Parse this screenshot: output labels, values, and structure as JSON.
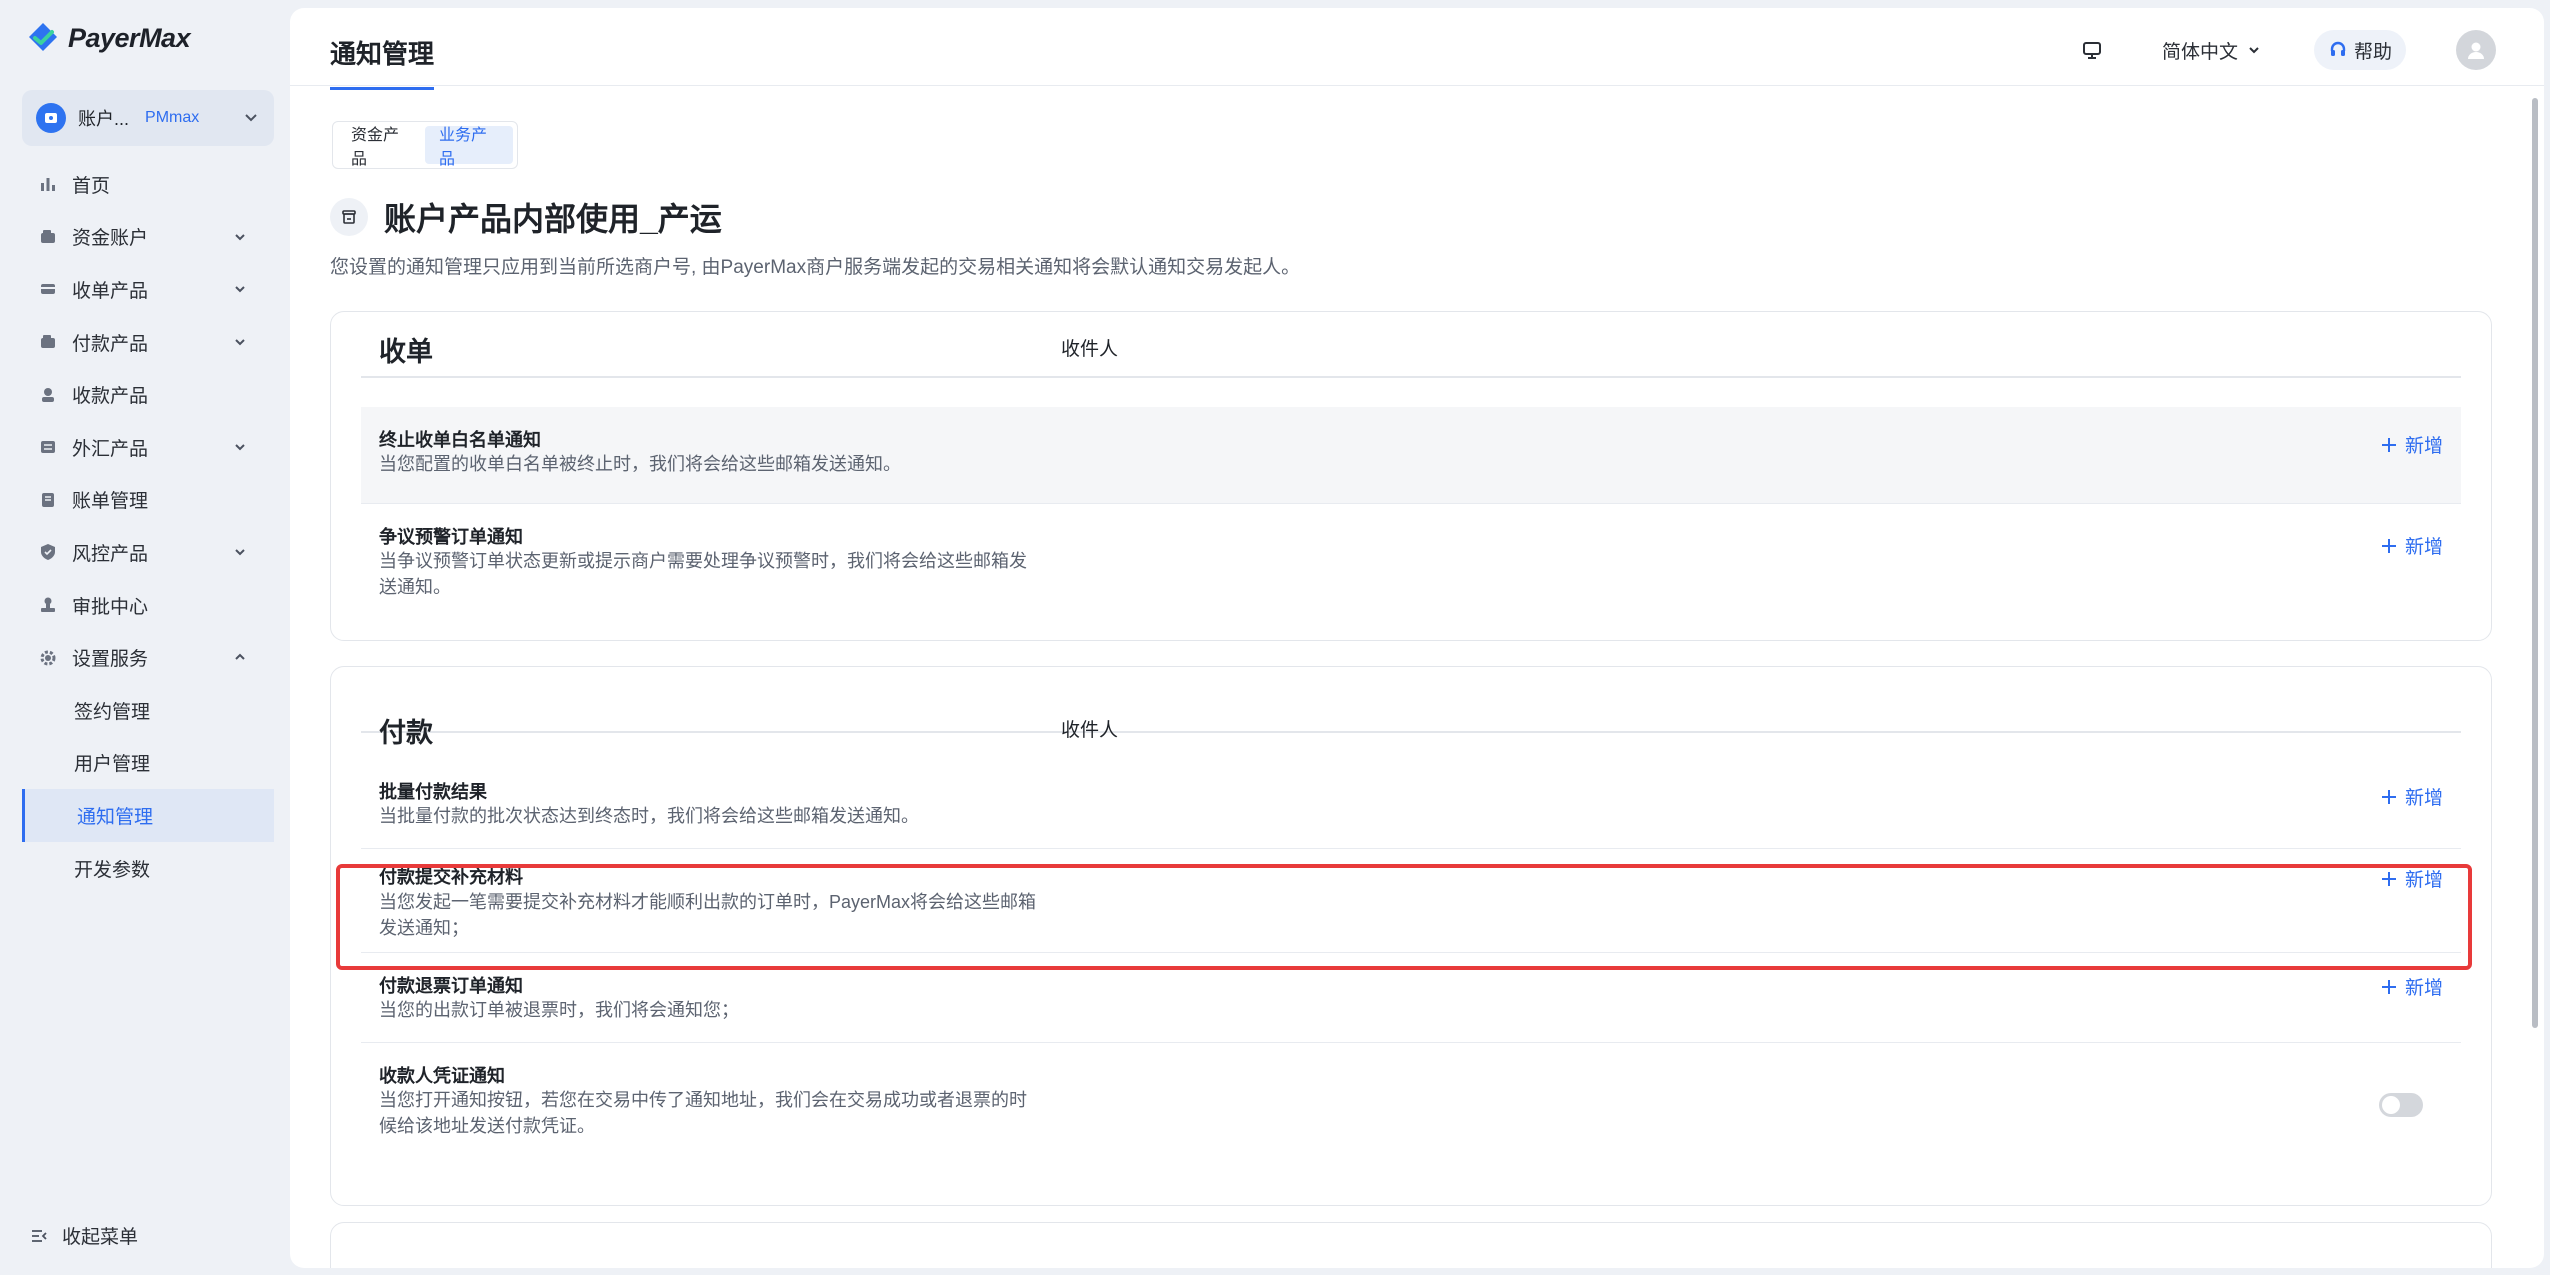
{
  "app": {
    "brand": "PayerMax",
    "colors": {
      "accent": "#2e6df0",
      "highlight": "#e83a3a",
      "sidebar_bg": "#eef1f6"
    }
  },
  "account": {
    "name": "账户...",
    "tag": "PMmax"
  },
  "sidebar": {
    "items": [
      {
        "label": "首页",
        "icon": "bar-chart-icon",
        "expandable": false
      },
      {
        "label": "资金账户",
        "icon": "wallet-icon",
        "expandable": true
      },
      {
        "label": "收单产品",
        "icon": "card-icon",
        "expandable": true
      },
      {
        "label": "付款产品",
        "icon": "wallet-icon",
        "expandable": true
      },
      {
        "label": "收款产品",
        "icon": "person-icon",
        "expandable": false
      },
      {
        "label": "外汇产品",
        "icon": "exchange-icon",
        "expandable": true
      },
      {
        "label": "账单管理",
        "icon": "bill-icon",
        "expandable": false
      },
      {
        "label": "风控产品",
        "icon": "shield-icon",
        "expandable": true
      },
      {
        "label": "审批中心",
        "icon": "stamp-icon",
        "expandable": false
      },
      {
        "label": "设置服务",
        "icon": "gear-icon",
        "expandable": true,
        "expanded": true
      }
    ],
    "sub_items": [
      {
        "label": "签约管理"
      },
      {
        "label": "用户管理"
      },
      {
        "label": "通知管理",
        "active": true
      },
      {
        "label": "开发参数"
      }
    ],
    "collapse_label": "收起菜单"
  },
  "header": {
    "tab": "通知管理",
    "language": "简体中文",
    "help": "帮助"
  },
  "segment": {
    "options": [
      "资金产品",
      "业务产品"
    ],
    "selected": "业务产品"
  },
  "page": {
    "title": "账户产品内部使用_产运",
    "description": "您设置的通知管理只应用到当前所选商户号, 由PayerMax商户服务端发起的交易相关通知将会默认通知交易发起人。"
  },
  "sections": [
    {
      "title": "收单",
      "receiver_header": "收件人",
      "rows": [
        {
          "title": "终止收单白名单通知",
          "desc": "当您配置的收单白名单被终止时，我们将会给这些邮箱发送通知。",
          "action": "新增"
        },
        {
          "title": "争议预警订单通知",
          "desc": "当争议预警订单状态更新或提示商户需要处理争议预警时，我们将会给这些邮箱发送通知。",
          "action": "新增"
        }
      ]
    },
    {
      "title": "付款",
      "receiver_header": "收件人",
      "rows": [
        {
          "title": "批量付款结果",
          "desc": "当批量付款的批次状态达到终态时，我们将会给这些邮箱发送通知。",
          "action": "新增"
        },
        {
          "title": "付款提交补充材料",
          "desc": "当您发起一笔需要提交补充材料才能顺利出款的订单时，PayerMax将会给这些邮箱发送通知；",
          "action": "新增"
        },
        {
          "title": "付款退票订单通知",
          "desc": "当您的出款订单被退票时，我们将会通知您；",
          "action": "新增"
        },
        {
          "title": "收款人凭证通知",
          "desc": "当您打开通知按钮，若您在交易中传了通知地址，我们会在交易成功或者退票的时候给该地址发送付款凭证。",
          "toggle": false
        }
      ]
    }
  ]
}
